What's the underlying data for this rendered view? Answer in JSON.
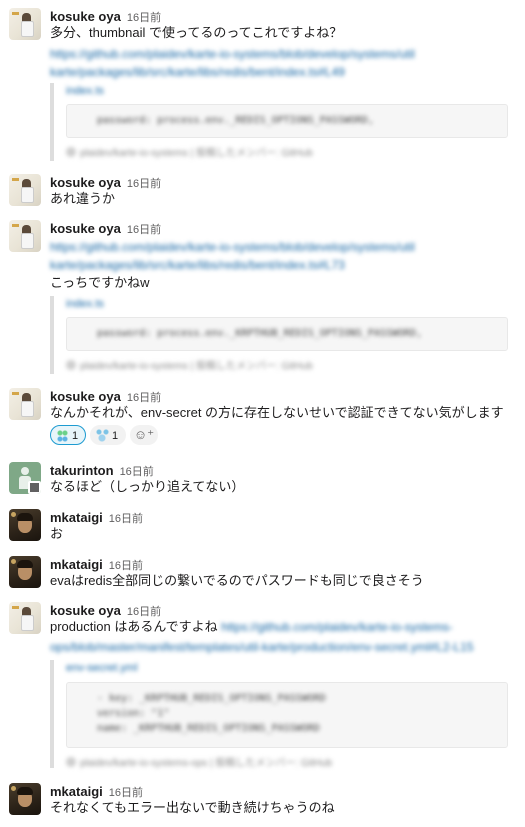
{
  "messages": [
    {
      "user": "kosuke oya",
      "time": "16日前",
      "text": "多分、thumbnail で使ってるのってこれですよね？",
      "link": [
        "https://github.com/plaidev/karte-io-systems/blob/develop/systems/util",
        "karte/packages/lib/src/karte/libs/redis/bent/index.ts#L49"
      ],
      "unfurl": {
        "title": "index.ts",
        "code": [
          "password: process.env._REDIS_OPTIONS_PASSWORD,"
        ],
        "footer": "plaidev/karte-io-systems | 投稿したメンバー: GitHub"
      }
    },
    {
      "user": "kosuke oya",
      "time": "16日前",
      "text": "あれ違うか"
    },
    {
      "user": "kosuke oya",
      "time": "16日前",
      "text": "こっちですかねw",
      "link": [
        "https://github.com/plaidev/karte-io-systems/blob/develop/systems/util",
        "karte/packages/lib/src/karte/libs/redis/bent/index.ts#L73"
      ],
      "unfurl": {
        "title": "index.ts",
        "code": [
          "password: process.env._KRPTHUB_REDIS_OPTIONS_PASSWORD,"
        ],
        "footer": "plaidev/karte-io-systems | 投稿したメンバー: GitHub"
      }
    },
    {
      "user": "kosuke oya",
      "time": "16日前",
      "text": "なんかそれが、env-secret の方に存在しないせいで認証できてない気がします",
      "reactions": [
        {
          "emoji": "grid-emoji",
          "count": "1",
          "active": true
        },
        {
          "emoji": "sparkle-emoji",
          "count": "1",
          "active": false
        }
      ]
    },
    {
      "user": "takurinton",
      "time": "16日前",
      "text": "なるほど（しっかり追えてない）"
    },
    {
      "user": "mkataigi",
      "time": "16日前",
      "text": "お"
    },
    {
      "user": "mkataigi",
      "time": "16日前",
      "text": "evaはredis全部同じの繋いでるのでパスワードも同じで良さそう"
    },
    {
      "user": "kosuke oya",
      "time": "16日前",
      "text": "production はあるんですよね",
      "link": [
        "https://github.com/plaidev/karte-io-systems-",
        "ops/blob/master/manifest/templates/util-karte/production/env-secret.yml#L2-L15"
      ],
      "unfurl": {
        "title": "env-secret.yml",
        "code": [
          "- key: _KRPTHUB_REDIS_OPTIONS_PASSWORD",
          "  version: \"1\"",
          "  name: _KRPTHUB_REDIS_OPTIONS_PASSWORD"
        ],
        "footer": "plaidev/karte-io-systems-ops | 投稿したメンバー: GitHub"
      }
    },
    {
      "user": "mkataigi",
      "time": "16日前",
      "text": "それなくてもエラー出ないで動き続けちゃうのね"
    }
  ],
  "colors": {
    "link": "#1264a3",
    "reaction_active_border": "#1d9bd1"
  },
  "icons": {
    "add_reaction": "add-reaction-icon"
  }
}
